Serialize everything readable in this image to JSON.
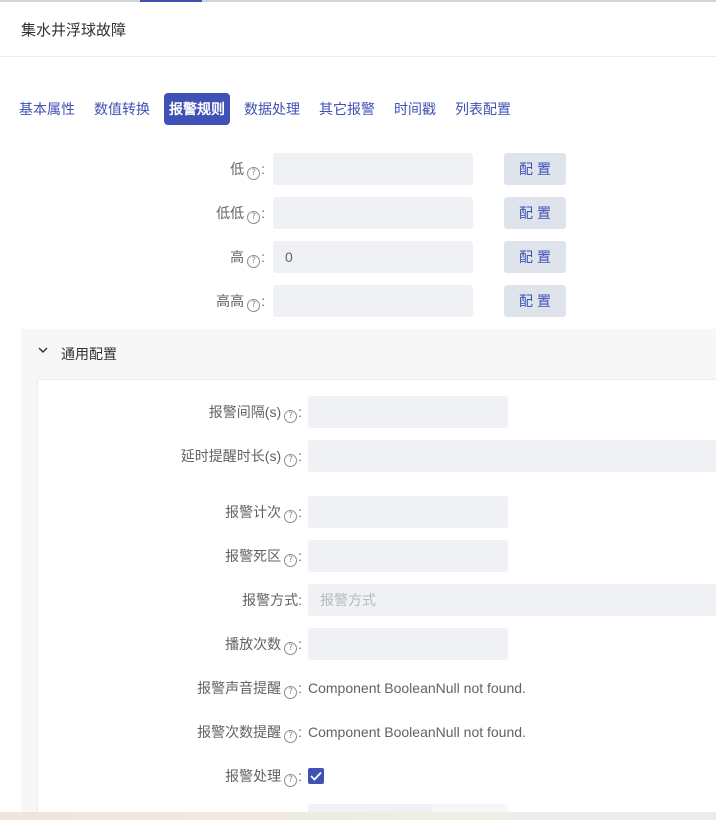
{
  "header": {
    "title": "集水井浮球故障"
  },
  "tabs": [
    {
      "label": "基本属性",
      "active": false
    },
    {
      "label": "数值转换",
      "active": false
    },
    {
      "label": "报警规则",
      "active": true
    },
    {
      "label": "数据处理",
      "active": false
    },
    {
      "label": "其它报警",
      "active": false
    },
    {
      "label": "时间戳",
      "active": false
    },
    {
      "label": "列表配置",
      "active": false
    }
  ],
  "colon": ":",
  "help_icon": "?",
  "rules": [
    {
      "label": "低",
      "value": "",
      "button": "配置"
    },
    {
      "label": "低低",
      "value": "",
      "button": "配置"
    },
    {
      "label": "高",
      "value": "0",
      "button": "配置"
    },
    {
      "label": "高高",
      "value": "",
      "button": "配置"
    }
  ],
  "general": {
    "title": "通用配置",
    "fields": {
      "alarm_interval": {
        "label": "报警间隔(s)",
        "value": ""
      },
      "delay_remind": {
        "label": "延时提醒时长(s)",
        "value": ""
      },
      "alarm_count": {
        "label": "报警计次",
        "value": ""
      },
      "dead_zone": {
        "label": "报警死区",
        "value": ""
      },
      "alarm_mode": {
        "label": "报警方式",
        "value": "",
        "placeholder": "报警方式"
      },
      "play_count": {
        "label": "播放次数",
        "value": ""
      },
      "sound_remind": {
        "label": "报警声音提醒",
        "text": "Component BooleanNull not found."
      },
      "count_remind": {
        "label": "报警次数提醒",
        "text": "Component BooleanNull not found."
      },
      "alarm_handle": {
        "label": "报警处理",
        "checked": true
      }
    }
  },
  "colors": {
    "accent": "#3f51b5",
    "input_bg": "#f0f1f4",
    "button_bg": "#dfe3ec"
  }
}
